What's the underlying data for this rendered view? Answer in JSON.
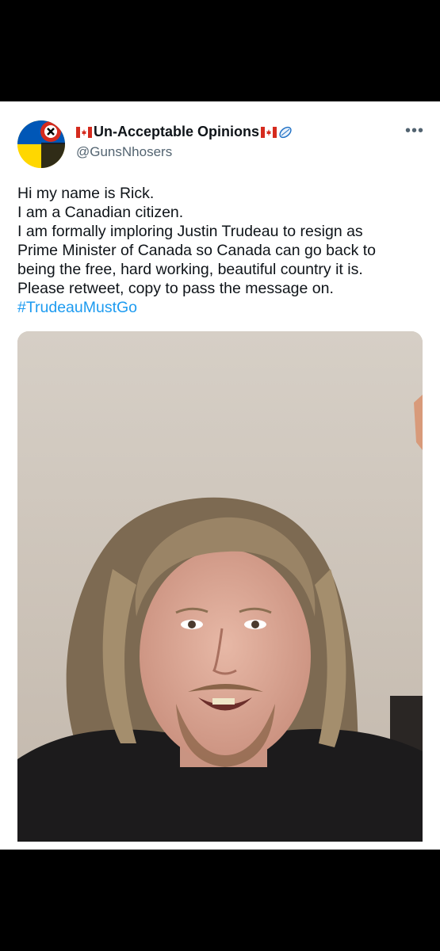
{
  "tweet": {
    "display_name": "Un-Acceptable Opinions",
    "handle": "@GunsNhosers",
    "more_icon": "more-options-icon",
    "lines": [
      "Hi my name is Rick.",
      "I am a Canadian citizen.",
      "I am formally imploring Justin Trudeau to resign as",
      "Prime Minister of Canada so Canada can go back to",
      "being the free, hard working, beautiful country it is.",
      "Please retweet, copy to pass the message on."
    ],
    "hashtag": "#TrudeauMustGo"
  },
  "colors": {
    "background": "#000000",
    "card": "#ffffff",
    "text": "#0f1419",
    "secondary": "#536471",
    "link": "#1d9bf0",
    "canada_red": "#d52b1e",
    "ukraine_blue": "#0057b7",
    "ukraine_yellow": "#ffd700"
  }
}
